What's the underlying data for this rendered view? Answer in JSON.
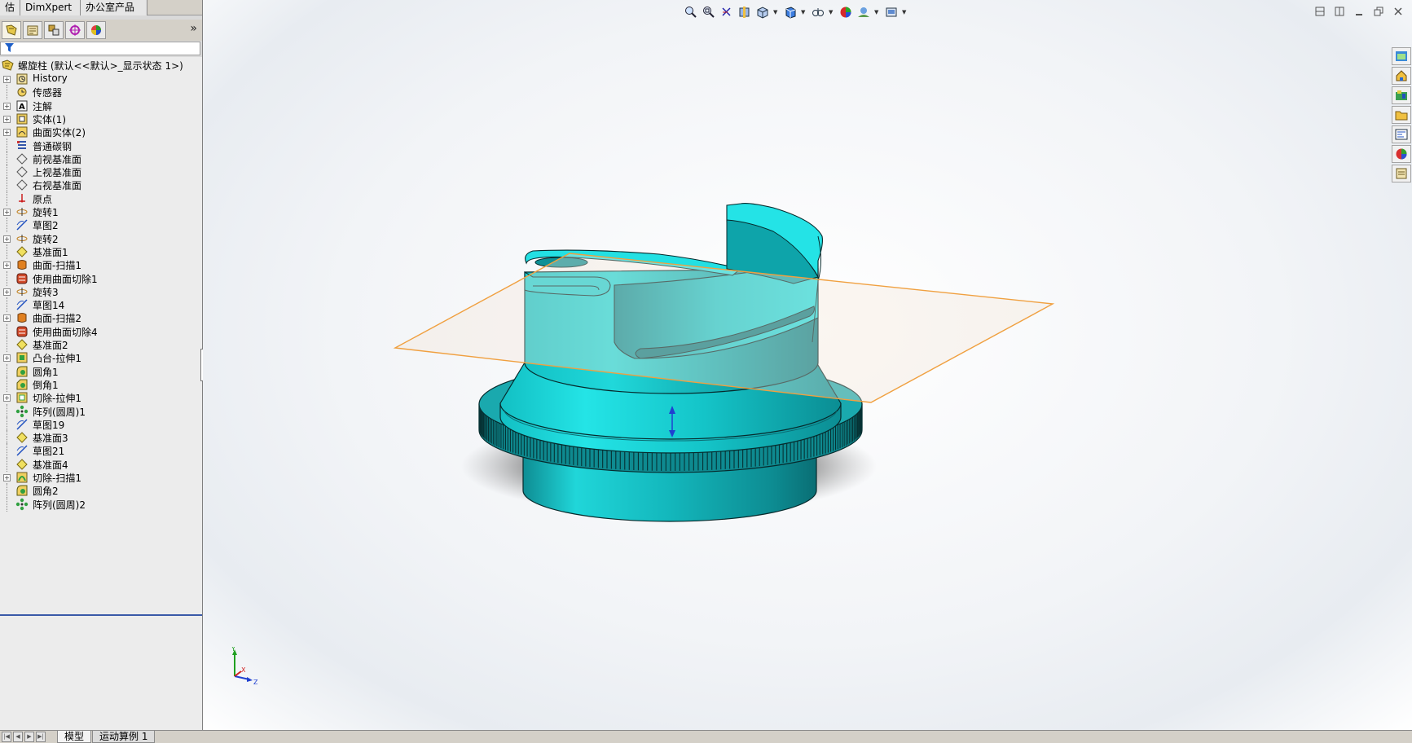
{
  "command_tabs": [
    {
      "label": "估"
    },
    {
      "label": "DimXpert"
    },
    {
      "label": "办公室产品"
    }
  ],
  "feature_manager": {
    "expand_glyph": "»",
    "root_label": "螺旋柱  (默认<<默认>_显示状态 1>)",
    "items": [
      {
        "label": "History",
        "icon": "history-icon",
        "expandable": true
      },
      {
        "label": "传感器",
        "icon": "sensor-icon",
        "expandable": false
      },
      {
        "label": "注解",
        "icon": "annotation-icon",
        "expandable": true
      },
      {
        "label": "实体(1)",
        "icon": "solid-bodies-icon",
        "expandable": true
      },
      {
        "label": "曲面实体(2)",
        "icon": "surface-bodies-icon",
        "expandable": true
      },
      {
        "label": "普通碳钢",
        "icon": "material-icon",
        "expandable": false
      },
      {
        "label": "前视基准面",
        "icon": "plane-icon",
        "expandable": false
      },
      {
        "label": "上视基准面",
        "icon": "plane-icon",
        "expandable": false
      },
      {
        "label": "右视基准面",
        "icon": "plane-icon",
        "expandable": false
      },
      {
        "label": "原点",
        "icon": "origin-icon",
        "expandable": false
      },
      {
        "label": "旋转1",
        "icon": "revolve-icon",
        "expandable": true
      },
      {
        "label": "草图2",
        "icon": "sketch-icon",
        "expandable": false
      },
      {
        "label": "旋转2",
        "icon": "revolve-icon",
        "expandable": true
      },
      {
        "label": "基准面1",
        "icon": "ref-plane-icon",
        "expandable": false
      },
      {
        "label": "曲面-扫描1",
        "icon": "surface-sweep-icon",
        "expandable": true
      },
      {
        "label": "使用曲面切除1",
        "icon": "surface-cut-icon",
        "expandable": false
      },
      {
        "label": "旋转3",
        "icon": "revolve-icon",
        "expandable": true
      },
      {
        "label": "草图14",
        "icon": "sketch-icon",
        "expandable": false
      },
      {
        "label": "曲面-扫描2",
        "icon": "surface-sweep-icon",
        "expandable": true
      },
      {
        "label": "使用曲面切除4",
        "icon": "surface-cut-icon",
        "expandable": false
      },
      {
        "label": "基准面2",
        "icon": "ref-plane-icon",
        "expandable": false
      },
      {
        "label": "凸台-拉伸1",
        "icon": "boss-extrude-icon",
        "expandable": true
      },
      {
        "label": "圆角1",
        "icon": "fillet-icon",
        "expandable": false
      },
      {
        "label": "倒角1",
        "icon": "chamfer-icon",
        "expandable": false
      },
      {
        "label": "切除-拉伸1",
        "icon": "cut-extrude-icon",
        "expandable": true
      },
      {
        "label": "阵列(圆周)1",
        "icon": "circular-pattern-icon",
        "expandable": false
      },
      {
        "label": "草图19",
        "icon": "sketch-icon",
        "expandable": false
      },
      {
        "label": "基准面3",
        "icon": "ref-plane-icon",
        "expandable": false
      },
      {
        "label": "草图21",
        "icon": "sketch-icon",
        "expandable": false
      },
      {
        "label": "基准面4",
        "icon": "ref-plane-icon",
        "expandable": false
      },
      {
        "label": "切除-扫描1",
        "icon": "cut-sweep-icon",
        "expandable": true
      },
      {
        "label": "圆角2",
        "icon": "fillet-icon",
        "expandable": false
      },
      {
        "label": "阵列(圆周)2",
        "icon": "circular-pattern-icon",
        "expandable": false
      }
    ]
  },
  "bottom_tabs": [
    {
      "label": "模型",
      "active": true
    },
    {
      "label": "运动算例 1",
      "active": false
    }
  ],
  "triad": {
    "x": "X",
    "y": "Y",
    "z": "Z"
  },
  "colors": {
    "model": "#1ec8cc",
    "model_dark": "#0f8f95",
    "plane_edge": "#f0a040",
    "tree_bg": "#ececec"
  }
}
